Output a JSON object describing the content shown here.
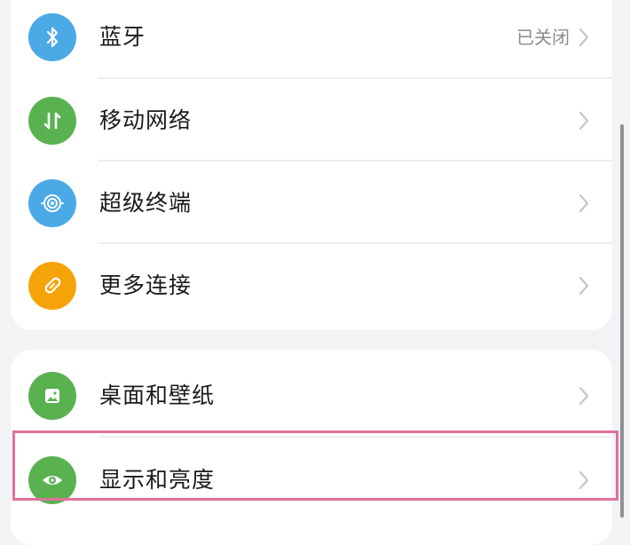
{
  "colors": {
    "bluetooth": "#4ba9e6",
    "mobile_network": "#5ab150",
    "super_terminal": "#4ba9e6",
    "more_connections": "#f6a30a",
    "wallpaper": "#5ab150",
    "display": "#5ab150",
    "highlight_border": "#e0729b"
  },
  "settings": {
    "group1": [
      {
        "label": "蓝牙",
        "status": "已关闭",
        "icon": "bluetooth-icon"
      },
      {
        "label": "移动网络",
        "icon": "mobile-data-icon"
      },
      {
        "label": "超级终端",
        "icon": "super-terminal-icon"
      },
      {
        "label": "更多连接",
        "icon": "link-icon"
      }
    ],
    "group2": [
      {
        "label": "桌面和壁纸",
        "icon": "wallpaper-icon"
      },
      {
        "label": "显示和亮度",
        "icon": "eye-icon",
        "highlighted": true
      }
    ]
  }
}
